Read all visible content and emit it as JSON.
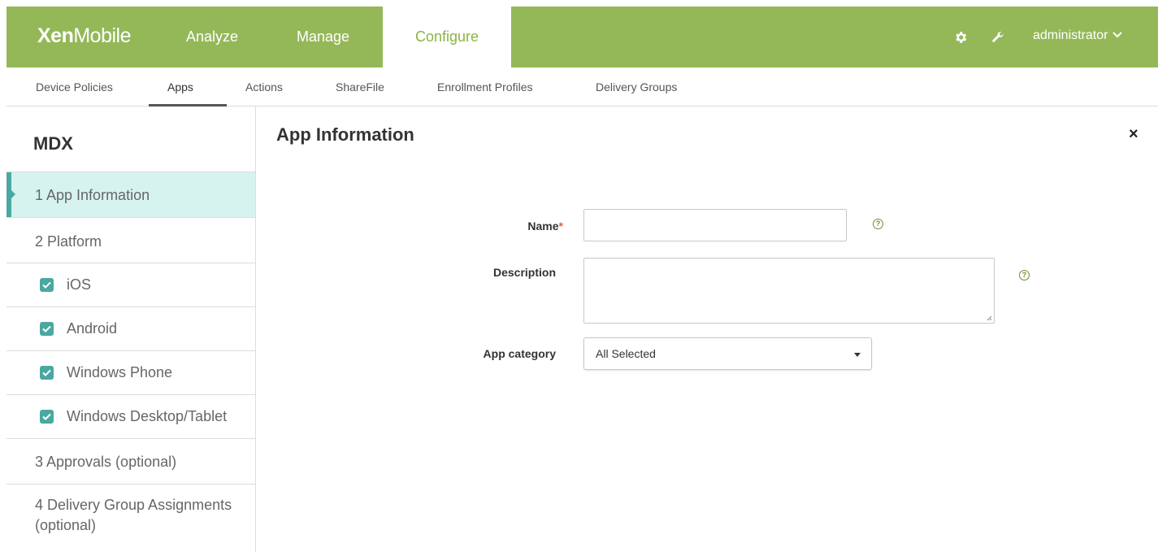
{
  "brand": {
    "bold": "Xen",
    "light": "Mobile"
  },
  "topnav": {
    "items": [
      "Analyze",
      "Manage",
      "Configure"
    ],
    "active": "Configure"
  },
  "user": {
    "name": "administrator"
  },
  "icons": {
    "settings": "gear-icon",
    "tools": "wrench-icon",
    "dropdown": "chevron-down-icon",
    "close": "close-icon",
    "help": "help-icon",
    "checkbox": "checkbox-checked-icon"
  },
  "subnav": {
    "items": [
      "Device Policies",
      "Apps",
      "Actions",
      "ShareFile",
      "Enrollment Profiles",
      "Delivery Groups"
    ],
    "active": "Apps"
  },
  "sidebar": {
    "title": "MDX",
    "steps": [
      {
        "label": "1  App Information"
      },
      {
        "label": "2  Platform"
      },
      {
        "label": "iOS",
        "checked": true
      },
      {
        "label": "Android",
        "checked": true
      },
      {
        "label": "Windows Phone",
        "checked": true
      },
      {
        "label": "Windows Desktop/Tablet",
        "checked": true
      },
      {
        "label": "3  Approvals (optional)"
      },
      {
        "label": "4  Delivery Group Assignments",
        "label2": "(optional)"
      }
    ]
  },
  "main": {
    "title": "App Information",
    "close_label": "×",
    "form": {
      "name_label": "Name",
      "required_mark": "*",
      "name_value": "",
      "description_label": "Description",
      "description_value": "",
      "category_label": "App category",
      "category_value": "All Selected",
      "help_glyph": "?"
    }
  },
  "colors": {
    "topbar": "#94b858",
    "active_tab_text": "#8bb541",
    "accent_teal": "#4aa8a0",
    "active_step_bg": "#d6f3f0",
    "required": "#e0624e"
  }
}
